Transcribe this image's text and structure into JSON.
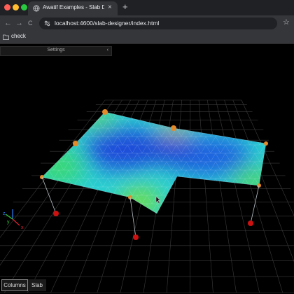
{
  "browser": {
    "tab": {
      "title": "Awatif Examples - Slab Designer",
      "close": "×"
    },
    "new_tab": "+",
    "nav": {
      "back": "←",
      "forward": "→",
      "reload": "C"
    },
    "url": {
      "host": "localhost",
      "rest": ":4600/slab-designer/index.html"
    },
    "star": "☆",
    "bookmark": {
      "label": "check"
    },
    "colors": {
      "tabbar": "#202124",
      "toolbar": "#35363a",
      "close": "#ff5f57",
      "minimize": "#febc2e",
      "maximize": "#28c840"
    }
  },
  "settings": {
    "title": "Settings",
    "arrow": "‹"
  },
  "axes": {
    "x": "x",
    "y": "y",
    "z": "z"
  },
  "buttons": {
    "columns": "Columns",
    "slab": "Slab"
  },
  "scene": {
    "column_color": "#cc1111",
    "mesh_palette": [
      "#1a3cd6",
      "#1e7ee0",
      "#22c7d8",
      "#2bd97a",
      "#7fe03a",
      "#c8c42e",
      "#e38a2a"
    ]
  }
}
